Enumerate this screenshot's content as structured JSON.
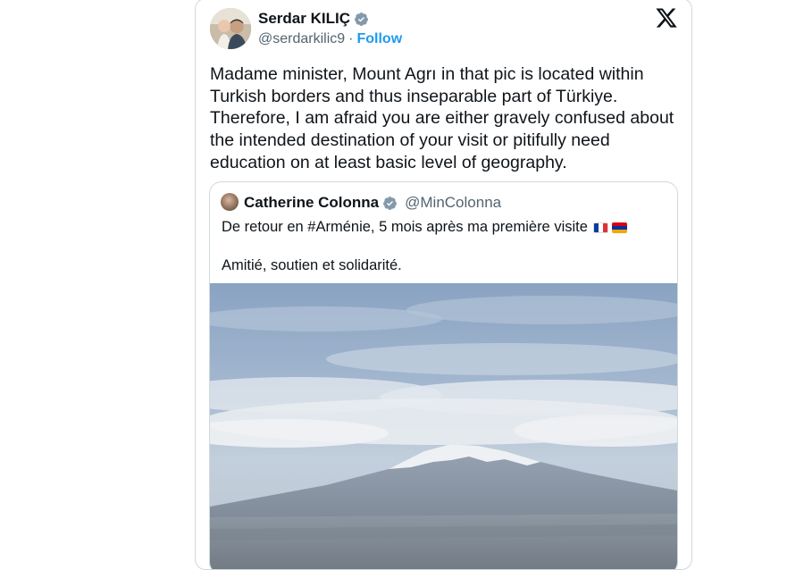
{
  "tweet": {
    "author_name": "Serdar KILIÇ",
    "author_handle": "@serdarkilic9",
    "separator": "·",
    "follow_label": "Follow",
    "text": "Madame minister, Mount Agrı in that pic is located within Turkish borders and thus inseparable part of Türkiye. Therefore, I am afraid you are either gravely confused about the intended destination of your visit or pitifully need education on at least basic level of geography."
  },
  "quoted_tweet": {
    "author_name": "Catherine Colonna",
    "author_handle": "@MinColonna",
    "line1": "De retour en #Arménie, 5 mois après ma première visite",
    "line2": "Amitié, soutien et solidarité."
  },
  "colors": {
    "accent": "#1d9bf0",
    "verified_badge": "#829aab",
    "text": "#0f1419",
    "muted": "#536471",
    "border": "#cfd9de"
  },
  "icons": {
    "verified": "verified-badge-icon",
    "platform_logo": "x-logo-icon",
    "flag_france": "flag-france-icon",
    "flag_armenia": "flag-armenia-icon"
  }
}
